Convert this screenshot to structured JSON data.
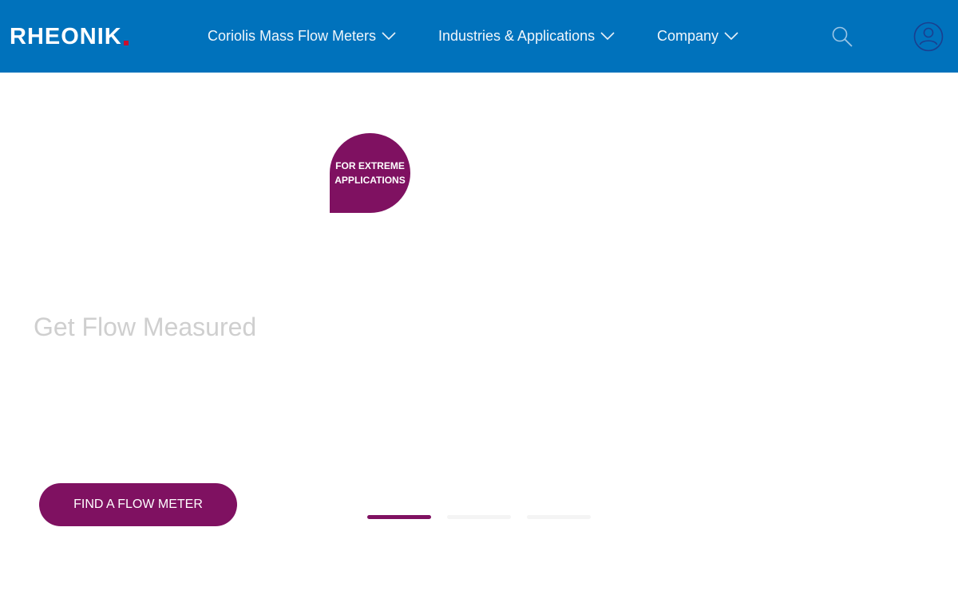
{
  "header": {
    "logo_text": "RHEONIK",
    "nav": [
      {
        "label": "Coriolis Mass Flow Meters"
      },
      {
        "label": "Industries & Applications"
      },
      {
        "label": "Company"
      }
    ],
    "icons": [
      "search-icon",
      "user-icon",
      "chevron-down-icon"
    ]
  },
  "hero": {
    "badge_line1": "FOR EXTREME",
    "badge_line2": "APPLICATIONS",
    "title": "Get Flow Measured",
    "cta_label": "FIND A FLOW METER",
    "slides_total": 3,
    "active_slide": 1
  },
  "colors": {
    "header_bg": "#0072bc",
    "brand_accent": "#7f1161",
    "logo_dot": "#c8102e",
    "inactive_dot": "#f4f4f4"
  }
}
